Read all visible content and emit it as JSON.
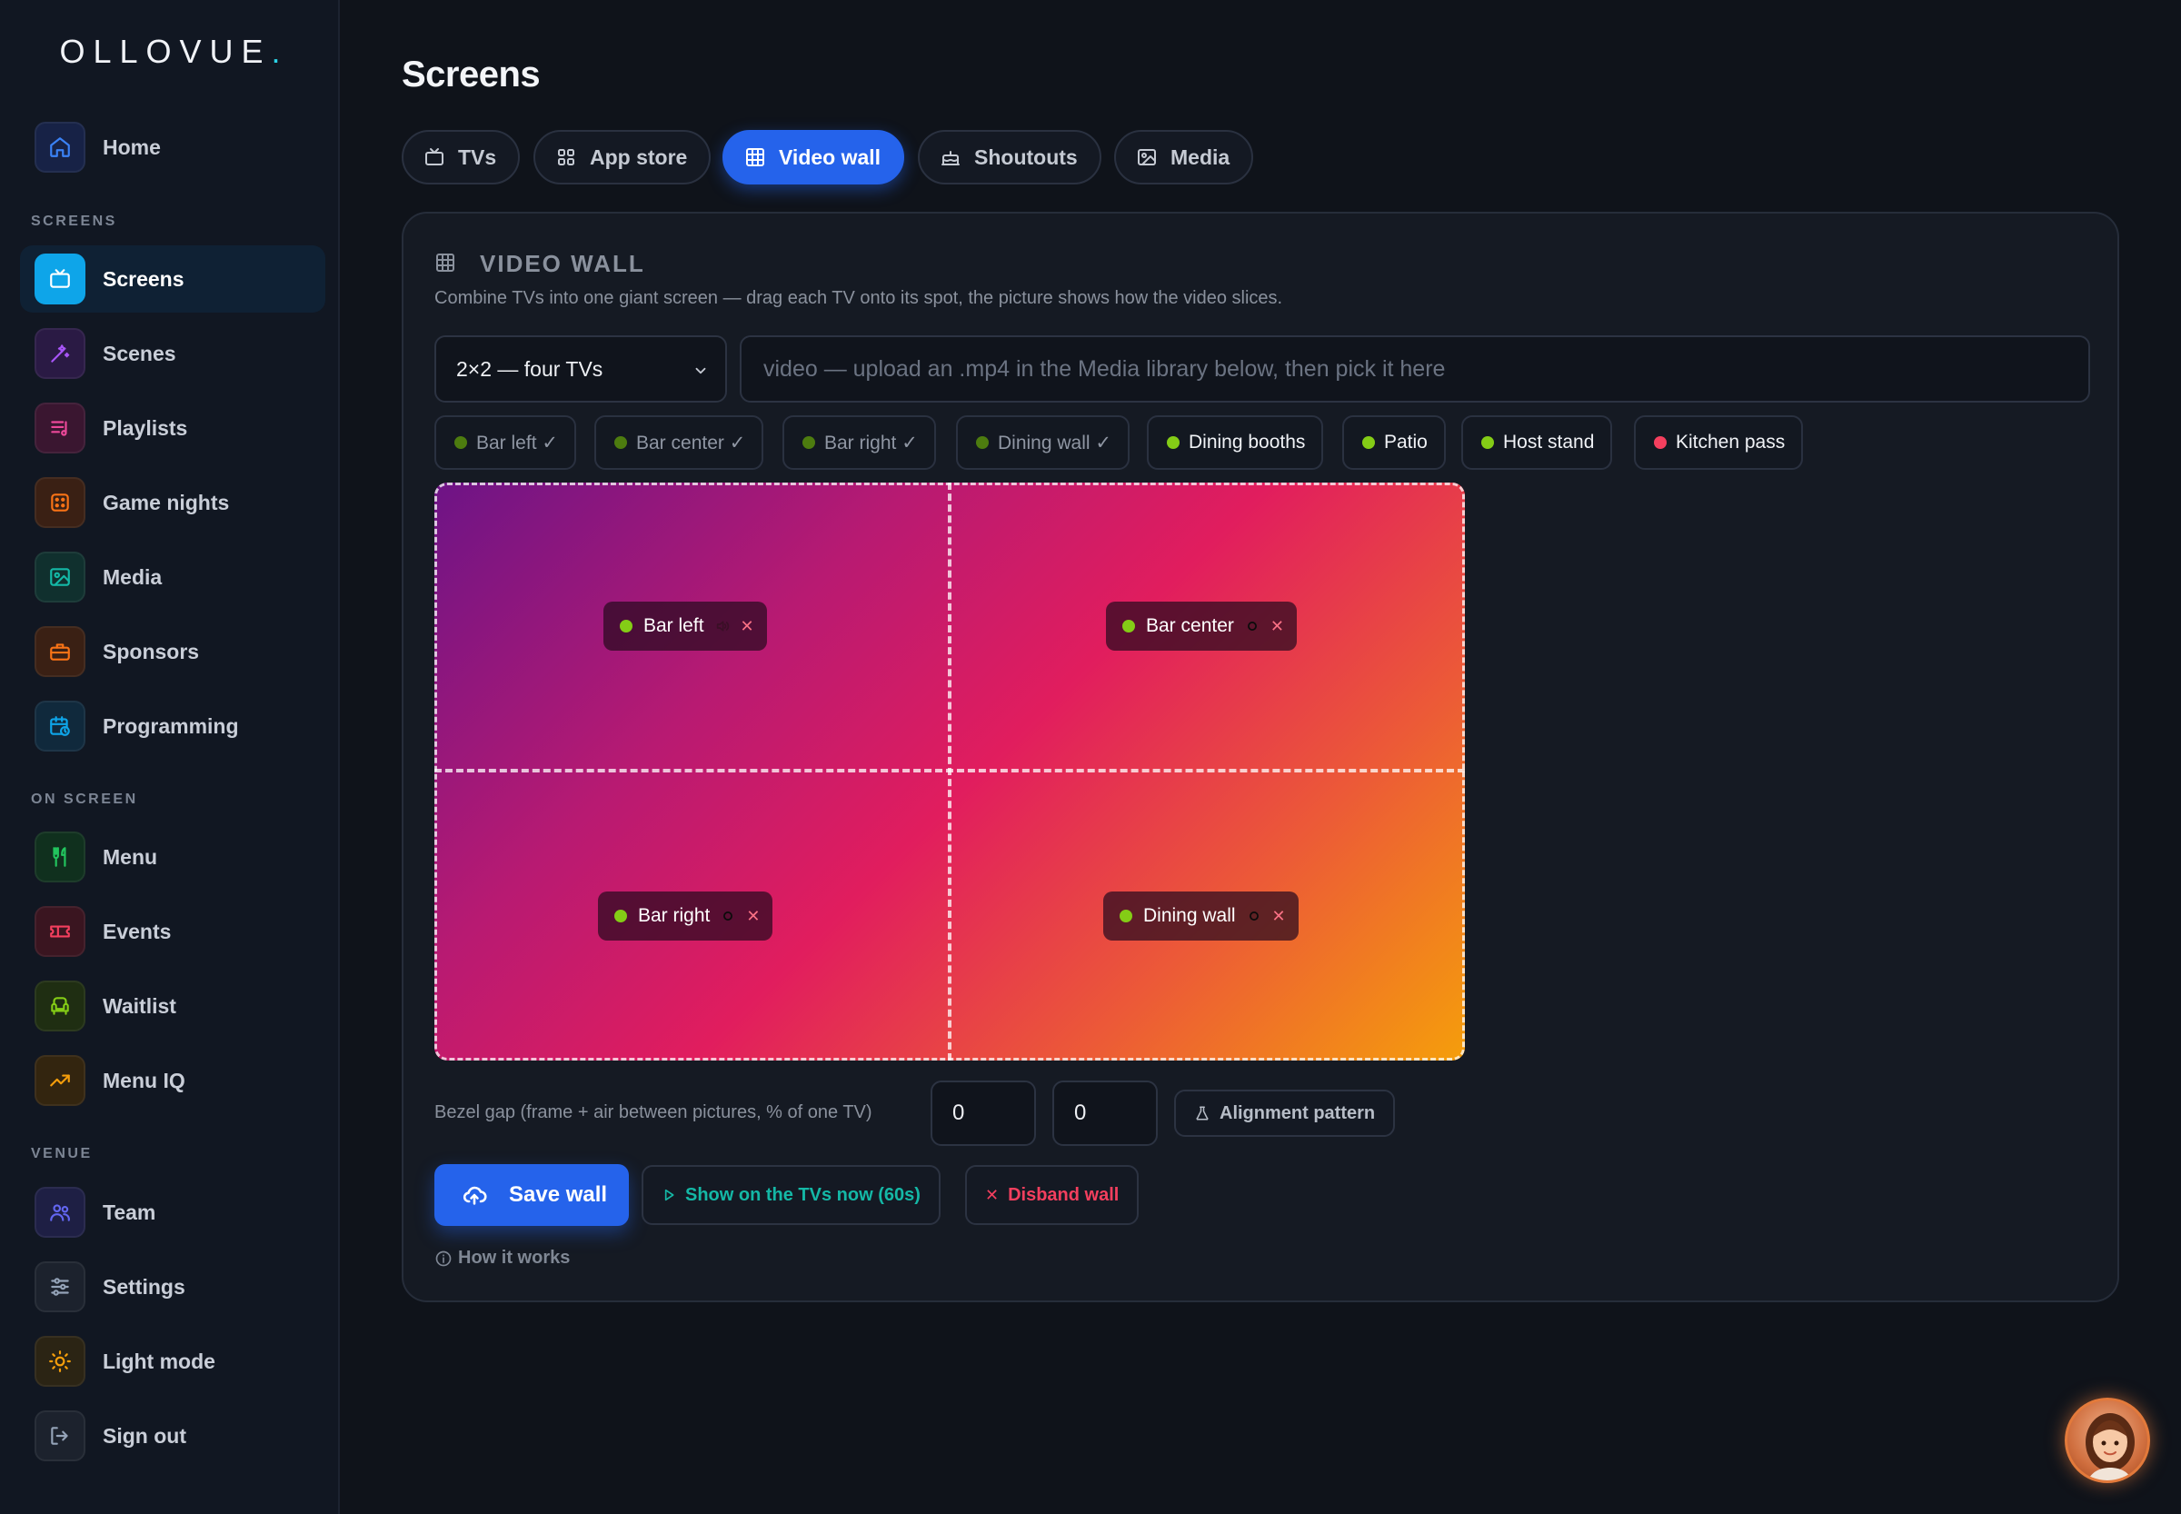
{
  "brand": {
    "logo": "OLLOVUE",
    "logo_dot": ".",
    "dot_color": "#2bd3e6"
  },
  "sidebar": {
    "items": [
      {
        "label": "Home",
        "icon": "home-icon",
        "color": "#3b82f6"
      },
      {
        "label": "Screens",
        "icon": "tv-icon",
        "color": "#0ea5e9",
        "active": true
      },
      {
        "label": "Scenes",
        "icon": "magic-wand-icon",
        "color": "#a855f7"
      },
      {
        "label": "Playlists",
        "icon": "playlist-icon",
        "color": "#ec4899"
      },
      {
        "label": "Game nights",
        "icon": "dice-icon",
        "color": "#f97316"
      },
      {
        "label": "Media",
        "icon": "image-icon",
        "color": "#14b8a6"
      },
      {
        "label": "Sponsors",
        "icon": "briefcase-icon",
        "color": "#f97316"
      },
      {
        "label": "Programming",
        "icon": "calendar-clock-icon",
        "color": "#0ea5e9"
      },
      {
        "label": "Menu",
        "icon": "utensils-icon",
        "color": "#22c55e"
      },
      {
        "label": "Events",
        "icon": "ticket-icon",
        "color": "#f43f5e"
      },
      {
        "label": "Waitlist",
        "icon": "armchair-icon",
        "color": "#84cc16"
      },
      {
        "label": "Menu IQ",
        "icon": "trending-up-icon",
        "color": "#f59e0b"
      },
      {
        "label": "Team",
        "icon": "users-icon",
        "color": "#6366f1"
      },
      {
        "label": "Settings",
        "icon": "sliders-icon",
        "color": "#94a3b8"
      },
      {
        "label": "Light mode",
        "icon": "sun-icon",
        "color": "#f59e0b"
      },
      {
        "label": "Sign out",
        "icon": "logout-icon",
        "color": "#94a3b8"
      }
    ],
    "sections": {
      "screens": "SCREENS",
      "on_screen": "ON SCREEN",
      "venue": "VENUE"
    }
  },
  "main": {
    "title": "Screens",
    "tabs": [
      {
        "label": "TVs",
        "icon": "tv-icon"
      },
      {
        "label": "App store",
        "icon": "grid-icon"
      },
      {
        "label": "Video wall",
        "icon": "video-wall-icon",
        "active": true
      },
      {
        "label": "Shoutouts",
        "icon": "cake-icon"
      },
      {
        "label": "Media",
        "icon": "image-icon"
      }
    ]
  },
  "panel": {
    "title": "VIDEO WALL",
    "description": "Combine TVs into one giant screen — drag each TV onto its spot, the picture shows how the video slices.",
    "layout_select": "2×2 — four TVs",
    "video_placeholder": "video — upload an .mp4 in the Media library below, then pick it here",
    "chips": [
      {
        "label": "Bar left ✓",
        "status": "placed"
      },
      {
        "label": "Bar center ✓",
        "status": "placed"
      },
      {
        "label": "Bar right ✓",
        "status": "placed"
      },
      {
        "label": "Dining wall ✓",
        "status": "placed"
      },
      {
        "label": "Dining booths",
        "status": "online"
      },
      {
        "label": "Patio",
        "status": "online"
      },
      {
        "label": "Host stand",
        "status": "online"
      },
      {
        "label": "Kitchen pass",
        "status": "offline"
      }
    ],
    "wall_cells": [
      {
        "label": "Bar left",
        "audio": true
      },
      {
        "label": "Bar center",
        "audio": false
      },
      {
        "label": "Bar right",
        "audio": false
      },
      {
        "label": "Dining wall",
        "audio": false
      }
    ],
    "bezel_label": "Bezel gap (frame + air between pictures, % of one TV)",
    "bezel_x": "0",
    "bezel_y": "0",
    "alignment_button": "Alignment pattern",
    "save_button": "Save wall",
    "show_button": "Show on the TVs now (60s)",
    "disband_button": "Disband wall",
    "how_it_works": "How it works"
  },
  "colors": {
    "accent": "#2563eb",
    "online": "#84cc16",
    "offline": "#f43f5e",
    "show_text": "#14b8a6",
    "disband_text": "#f43f5e"
  }
}
